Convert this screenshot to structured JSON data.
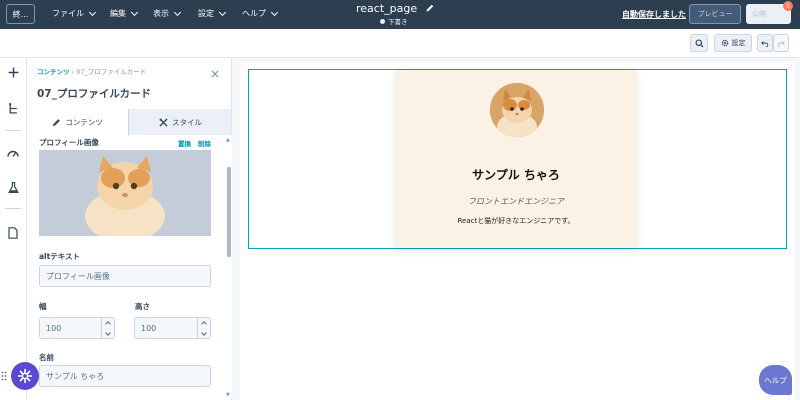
{
  "topbar": {
    "exit_label": "終...",
    "menus": [
      "ファイル",
      "編集",
      "表示",
      "設定",
      "ヘルプ"
    ],
    "page_title": "react_page",
    "status": "下書き",
    "autosave_label": "自動保存しました",
    "preview_label": "プレビュー",
    "publish_label": "公開",
    "notification_count": "5"
  },
  "subbar": {
    "settings_label": "設定"
  },
  "panel": {
    "breadcrumb_root": "コンテンツ",
    "breadcrumb_sep": "‹",
    "breadcrumb_current": "07_プロファイルカード",
    "title": "07_プロファイルカード",
    "tabs": [
      {
        "label": "コンテンツ",
        "icon": "pencil-icon"
      },
      {
        "label": "スタイル",
        "icon": "brush-icon"
      }
    ],
    "image_label": "プロフィール画像",
    "replace_label": "置換",
    "remove_label": "削除",
    "alt_label": "altテキスト",
    "alt_value": "プロフィール画像",
    "width_label": "幅",
    "width_value": "100",
    "height_label": "高さ",
    "height_value": "100",
    "dimension_sep": "x",
    "name_label": "名前",
    "name_value": "サンプル ちゃろ"
  },
  "card": {
    "name": "サンプル ちゃろ",
    "role": "フロントエンドエンジニア",
    "description": "Reactと猫が好きなエンジニアです。"
  },
  "help_label": "ヘルプ",
  "colors": {
    "topbar": "#2d3e50",
    "accent": "#0091ae",
    "selection": "#00a4bd",
    "card_bg": "#fbf1e5",
    "fab": "#5b4ad1",
    "help": "#6a78d1"
  }
}
